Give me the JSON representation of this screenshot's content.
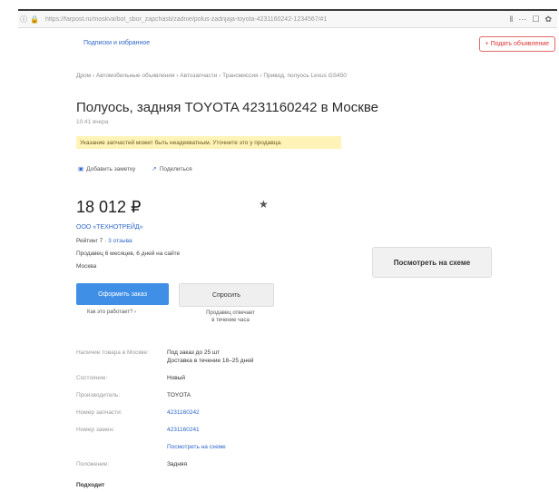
{
  "browser": {
    "url": "https://farpost.ru/moskva/bot_sbor_zapchasti/zadnie/polus-zadnjaja-toyota-4231160242-1234567/#1",
    "menu_icons": [
      "‖",
      "···",
      "☐",
      "✿"
    ]
  },
  "header": {
    "favorites_link": "Подписки и избранное",
    "post_button": "+ Подать объявление"
  },
  "breadcrumb": "Дром  ›  Автомобильные объявления  ›  Автозапчасти  ›  Трансмиссия  ›  Привод, полуось Lexus GS450",
  "listing": {
    "title": "Полуось, задняя TOYOTA 4231160242 в Москве",
    "time": "10:41 вчера",
    "warning": "Указание запчастей может быть неадекватным. Уточните это у продавца.",
    "add_note": "Добавить заметку",
    "share": "Поделиться",
    "price": "18 012 ₽",
    "star": "★",
    "seller": "ООО «ТЕХНОТРЕЙД»",
    "rating_prefix": "Рейтинг 7 · ",
    "rating_reviews": "3 отзыва",
    "sells_since": "Продавец 6 месяцев, 6 дней на сайте",
    "city": "Москва"
  },
  "buttons": {
    "order": "Оформить заказ",
    "ask": "Спросить",
    "map": "Посмотреть на схеме"
  },
  "notes": {
    "how_it_works": "Как это работает? ›",
    "responds": "Продавец отвечает\nв течение часа"
  },
  "specs": [
    {
      "key": "Наличие товара в Москве:",
      "value": "Под заказ до 25 шт\nДоставка в течение 18–25 дней",
      "link": false
    },
    {
      "key": "Состояние:",
      "value": "Новый",
      "link": false
    },
    {
      "key": "Производитель:",
      "value": "TOYOTA",
      "link": false
    },
    {
      "key": "Номер запчасти:",
      "value": "4231160242",
      "link": true
    },
    {
      "key": "Номер замен:",
      "value": "4231160241",
      "link": true
    },
    {
      "key": "",
      "value": "Посмотреть на схеме",
      "link": true
    },
    {
      "key": "Положение:",
      "value": "Задняя",
      "link": false
    }
  ],
  "fits_label": "Подходит"
}
